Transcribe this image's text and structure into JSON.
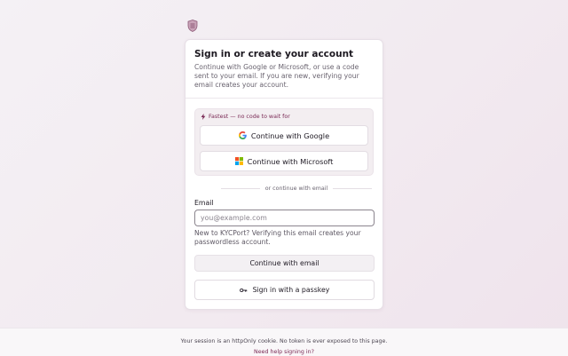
{
  "header": {
    "logo_icon": "shield-logo-icon"
  },
  "card": {
    "title": "Sign in or create your account",
    "subtitle": "Continue with Google or Microsoft, or use a code sent to your email. If you are new, verifying your email creates your account."
  },
  "fast": {
    "label": "Fastest — no code to wait for",
    "icon": "lightning-icon",
    "google_label": "Continue with Google",
    "microsoft_label": "Continue with Microsoft"
  },
  "divider": {
    "text": "or continue with email"
  },
  "email": {
    "label": "Email",
    "placeholder": "you@example.com",
    "hint": "New to KYCPort? Verifying this email creates your passwordless account.",
    "button_label": "Continue with email"
  },
  "passkey": {
    "label": "Sign in with a passkey",
    "icon": "key-icon"
  },
  "footer": {
    "note": "Your session is an httpOnly cookie. No token is ever exposed to this page.",
    "help_link": "Need help signing in?"
  },
  "colors": {
    "accent": "#7a2a55",
    "background": "#f3edf2",
    "card": "#ffffff"
  }
}
